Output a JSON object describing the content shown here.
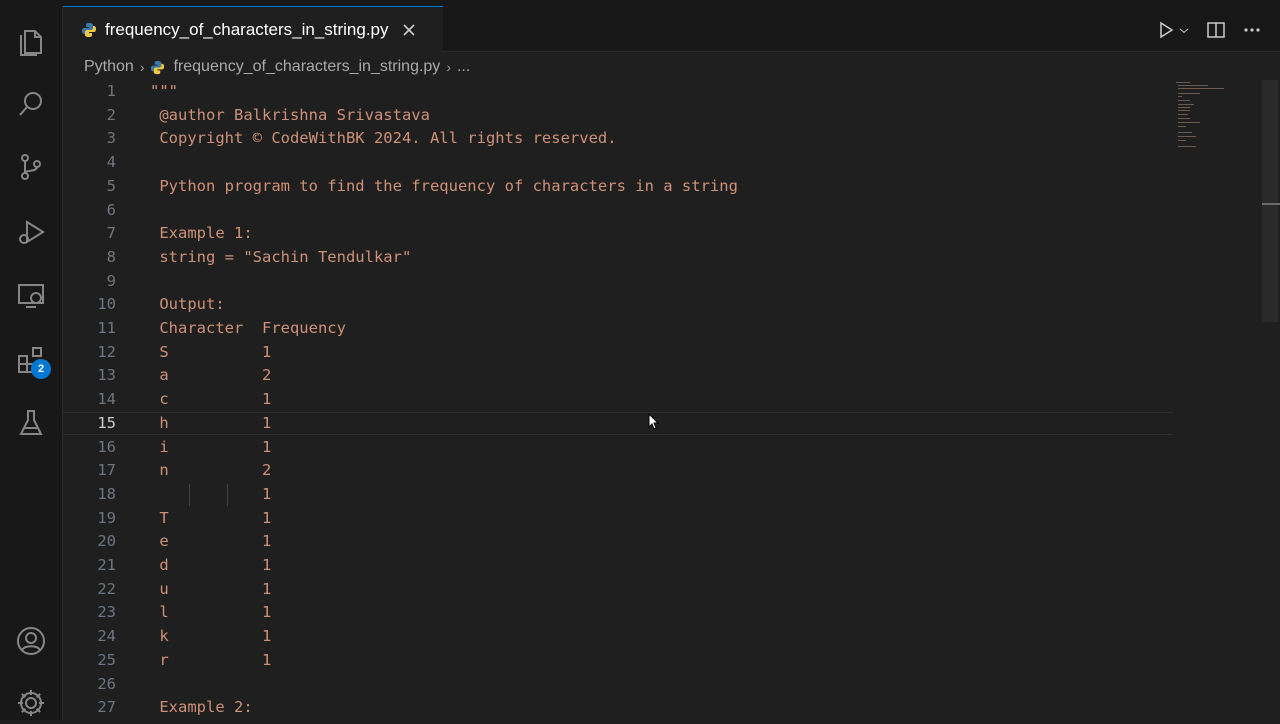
{
  "editor": {
    "tab_label": "frequency_of_characters_in_string.py",
    "breadcrumb": {
      "folder": "Python",
      "file": "frequency_of_characters_in_string.py",
      "more": "..."
    },
    "current_line": 15,
    "lines": [
      {
        "n": "1",
        "text": "\"\"\""
      },
      {
        "n": "2",
        "text": " @author Balkrishna Srivastava"
      },
      {
        "n": "3",
        "text": " Copyright © CodeWithBK 2024. All rights reserved."
      },
      {
        "n": "4",
        "text": ""
      },
      {
        "n": "5",
        "text": " Python program to find the frequency of characters in a string"
      },
      {
        "n": "6",
        "text": ""
      },
      {
        "n": "7",
        "text": " Example 1:"
      },
      {
        "n": "8",
        "text": " string = \"Sachin Tendulkar\""
      },
      {
        "n": "9",
        "text": ""
      },
      {
        "n": "10",
        "text": " Output:"
      },
      {
        "n": "11",
        "text": " Character  Frequency"
      },
      {
        "n": "12",
        "text": " S          1"
      },
      {
        "n": "13",
        "text": " a          2"
      },
      {
        "n": "14",
        "text": " c          1"
      },
      {
        "n": "15",
        "text": " h          1"
      },
      {
        "n": "16",
        "text": " i          1"
      },
      {
        "n": "17",
        "text": " n          2"
      },
      {
        "n": "18",
        "text": "            1"
      },
      {
        "n": "19",
        "text": " T          1"
      },
      {
        "n": "20",
        "text": " e          1"
      },
      {
        "n": "21",
        "text": " d          1"
      },
      {
        "n": "22",
        "text": " u          1"
      },
      {
        "n": "23",
        "text": " l          1"
      },
      {
        "n": "24",
        "text": " k          1"
      },
      {
        "n": "25",
        "text": " r          1"
      },
      {
        "n": "26",
        "text": ""
      },
      {
        "n": "27",
        "text": " Example 2:"
      }
    ]
  },
  "activity_bar": {
    "icons": [
      "files-icon",
      "search-icon",
      "source-control-icon",
      "run-debug-icon",
      "remote-explorer-icon",
      "extensions-icon",
      "testing-icon",
      "account-icon",
      "settings-gear-icon"
    ],
    "extensions_badge": "2"
  },
  "colors": {
    "string": "#ce9178",
    "accent": "#0078d4",
    "background": "#1f1f1f"
  }
}
